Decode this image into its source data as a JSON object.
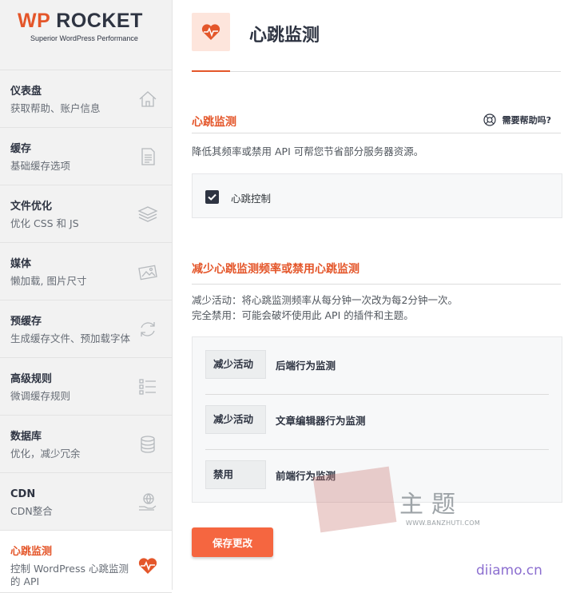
{
  "logo": {
    "brand_a": "WP",
    "brand_b": "ROCKET",
    "tagline": "Superior WordPress Performance"
  },
  "sidebar": {
    "items": [
      {
        "title": "仪表盘",
        "sub": "获取帮助、账户信息",
        "icon": "home-icon"
      },
      {
        "title": "缓存",
        "sub": "基础缓存选项",
        "icon": "document-icon"
      },
      {
        "title": "文件优化",
        "sub": "优化 CSS 和 JS",
        "icon": "layers-icon"
      },
      {
        "title": "媒体",
        "sub": "懒加载, 图片尺寸",
        "icon": "image-icon"
      },
      {
        "title": "预缓存",
        "sub": "生成缓存文件、预加载字体",
        "icon": "refresh-icon"
      },
      {
        "title": "高级规则",
        "sub": "微调缓存规则",
        "icon": "checklist-icon"
      },
      {
        "title": "数据库",
        "sub": "优化，减少冗余",
        "icon": "database-icon"
      },
      {
        "title": "CDN",
        "sub": "CDN整合",
        "icon": "cdn-icon"
      },
      {
        "title": "心跳监测",
        "sub": "控制 WordPress 心跳监测的 API",
        "icon": "heartbeat-icon",
        "active": true
      }
    ]
  },
  "header": {
    "title": "心跳监测",
    "icon": "heartbeat-icon"
  },
  "section1": {
    "title": "心跳监测",
    "help": "需要帮助吗?",
    "desc": "降低其频率或禁用 API 可帮您节省部分服务器资源。",
    "checkbox_label": "心跳控制",
    "checked": true
  },
  "section2": {
    "title": "减少心跳监测频率或禁用心跳监测",
    "desc1": "减少活动：将心跳监测频率从每分钟一次改为每2分钟一次。",
    "desc2": "完全禁用：可能会破坏使用此 API 的插件和主题。",
    "rows": [
      {
        "value": "减少活动",
        "label": "后端行为监测"
      },
      {
        "value": "减少活动",
        "label": "文章编辑器行为监测"
      },
      {
        "value": "禁用",
        "label": "前端行为监测"
      }
    ]
  },
  "save_label": "保存更改",
  "watermark": {
    "text": "主题",
    "url": "WWW.BANZHUTI.COM",
    "site": "diiamo.cn"
  },
  "colors": {
    "accent": "#e4562a",
    "button": "#f56640",
    "dark": "#2e3442",
    "sidebar_bg": "#f2f2f2"
  }
}
